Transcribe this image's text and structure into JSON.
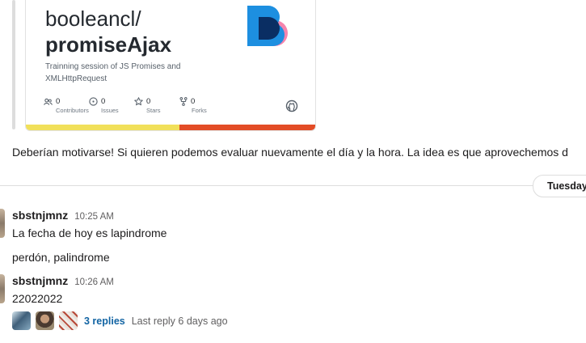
{
  "card": {
    "owner": "booleancl/",
    "repo": "promiseAjax",
    "description": "Trainning session of JS Promises and XMLHttpRequest",
    "stats": [
      {
        "icon": "contributors-icon",
        "value": "0",
        "label": "Contributors"
      },
      {
        "icon": "issues-icon",
        "value": "0",
        "label": "Issues"
      },
      {
        "icon": "star-icon",
        "value": "0",
        "label": "Stars"
      },
      {
        "icon": "fork-icon",
        "value": "0",
        "label": "Forks"
      }
    ],
    "lang_colors": {
      "javascript": "#f1e05a",
      "html": "#e34c26"
    }
  },
  "prev_message": "Deberían motivarse! Si quieren podemos evaluar nuevamente el día y la hora. La idea es que aprovechemos d",
  "date_divider": "Tuesday,",
  "messages": [
    {
      "user": "sbstnjmnz",
      "time": "10:25 AM",
      "lines": [
        "La fecha de hoy es lapindrome",
        "perdón, palindrome"
      ]
    },
    {
      "user": "sbstnjmnz",
      "time": "10:26 AM",
      "lines": [
        "22022022"
      ]
    }
  ],
  "thread": {
    "replies": "3 replies",
    "last_reply": "Last reply 6 days ago"
  }
}
